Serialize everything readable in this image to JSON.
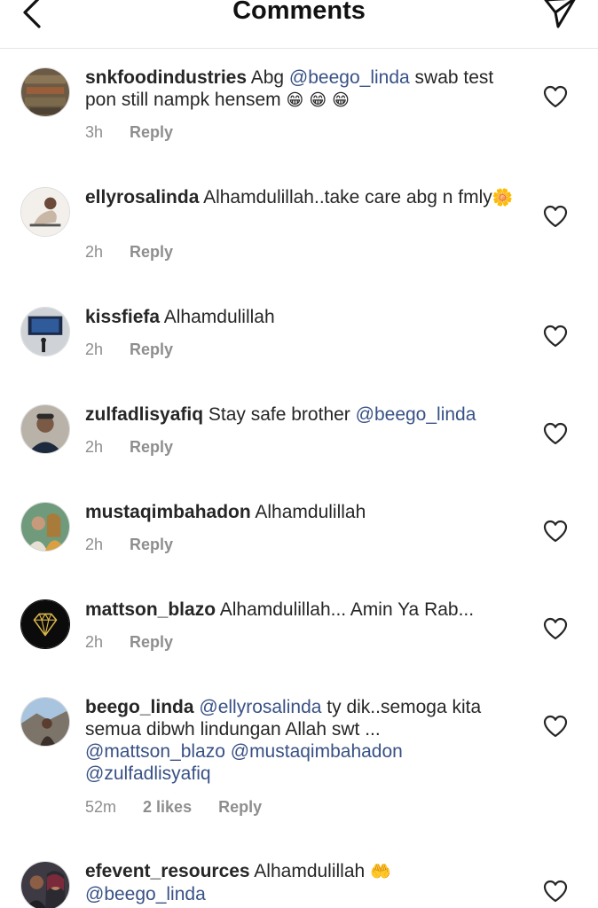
{
  "header": {
    "title": "Comments",
    "back_icon": "chevron-left-icon",
    "send_icon": "paper-plane-icon"
  },
  "comments": [
    {
      "username": "snkfoodindustries",
      "text_parts": [
        "Abg ",
        "@beego_linda",
        " swab test pon still nampk hensem",
        "😁 😁 😁"
      ],
      "time": "3h",
      "reply": "Reply"
    },
    {
      "username": "ellyrosalinda",
      "text_parts": [
        "Alhamdulillah..take care abg n fmly",
        "🌼"
      ],
      "time": "2h",
      "reply": "Reply"
    },
    {
      "username": "kissfiefa",
      "text_parts": [
        "Alhamdulillah"
      ],
      "time": "2h",
      "reply": "Reply"
    },
    {
      "username": "zulfadlisyafiq",
      "text_parts": [
        "Stay safe brother ",
        "@beego_linda"
      ],
      "time": "2h",
      "reply": "Reply"
    },
    {
      "username": "mustaqimbahadon",
      "text_parts": [
        "Alhamdulillah"
      ],
      "time": "2h",
      "reply": "Reply"
    },
    {
      "username": "mattson_blazo",
      "text_parts": [
        "Alhamdulillah... Amin Ya Rab..."
      ],
      "time": "2h",
      "reply": "Reply"
    },
    {
      "username": "beego_linda",
      "text_parts": [
        "@ellyrosalinda",
        " ty dik..semoga kita semua dibwh lindungan Allah swt ... ",
        "@mattson_blazo",
        " ",
        "@mustaqimbahadon",
        " ",
        "@zulfadlisyafiq"
      ],
      "time": "52m",
      "likes": "2 likes",
      "reply": "Reply"
    },
    {
      "username": "efevent_resources",
      "text_parts": [
        "Alhamdulillah ",
        "🤲",
        " ",
        "@beego_linda"
      ],
      "time": "",
      "reply": ""
    }
  ],
  "colors": {
    "text": "#262626",
    "mention": "#385185",
    "meta": "#8e8e8e",
    "divider": "#e6e6e6"
  }
}
